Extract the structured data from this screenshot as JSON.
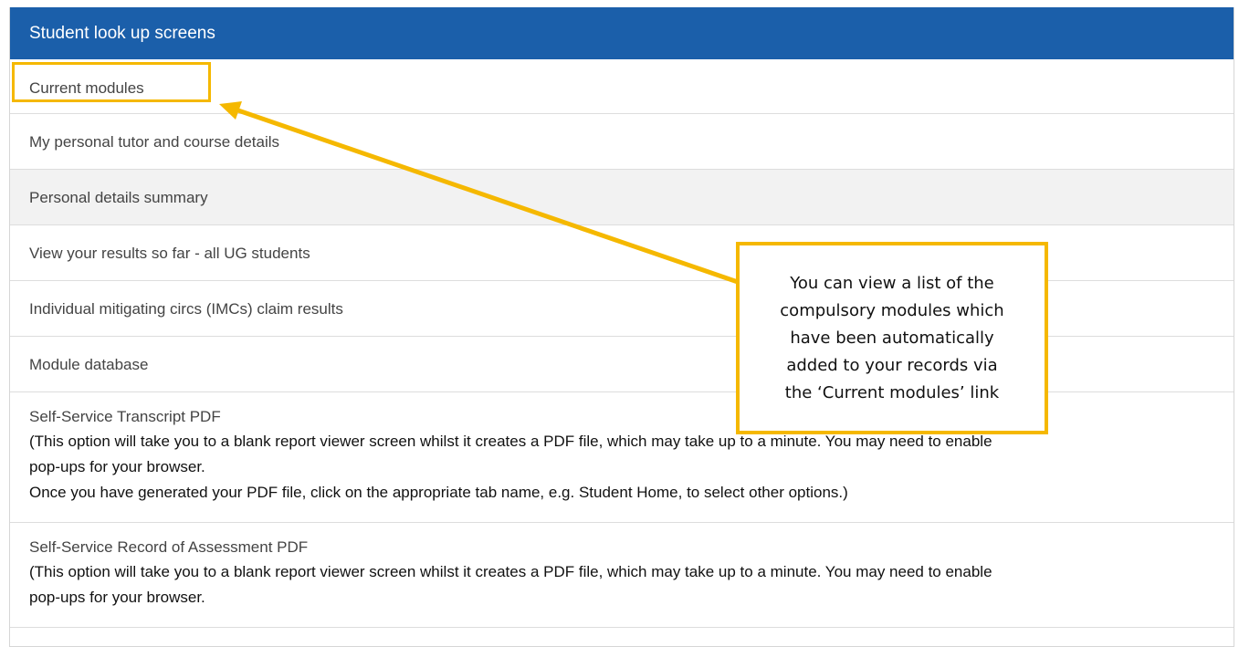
{
  "panel": {
    "title": "Student look up screens",
    "items": [
      {
        "label": "Current modules"
      },
      {
        "label": "My personal tutor and course details"
      },
      {
        "label": "Personal details summary"
      },
      {
        "label": "View your results so far - all UG students"
      },
      {
        "label": "Individual mitigating circs (IMCs) claim results"
      },
      {
        "label": "Module database"
      }
    ],
    "transcript": {
      "label": "Self-Service Transcript PDF",
      "note_line1": "(This option will take you to a blank report viewer screen whilst it creates a PDF file, which may take up to a minute. You may need to enable",
      "note_line2": "pop-ups for your browser.",
      "note_line3": "Once you have generated your PDF file, click on the appropriate tab name, e.g. Student Home, to select other options.)"
    },
    "assessment": {
      "label": "Self-Service Record of Assessment PDF",
      "note_line1": "(This option will take you to a blank report viewer screen whilst it creates a PDF file, which may take up to a minute. You may need to enable",
      "note_line2": "pop-ups for your browser."
    }
  },
  "callout": {
    "line1": "You can view a list of the",
    "line2": "compulsory modules which",
    "line3": "have been automatically",
    "line4": "added to your records via",
    "line5": "the ‘Current modules’ link"
  },
  "colors": {
    "header": "#1b5faa",
    "highlight": "#f5b800",
    "shaded_row": "#f2f2f2"
  }
}
